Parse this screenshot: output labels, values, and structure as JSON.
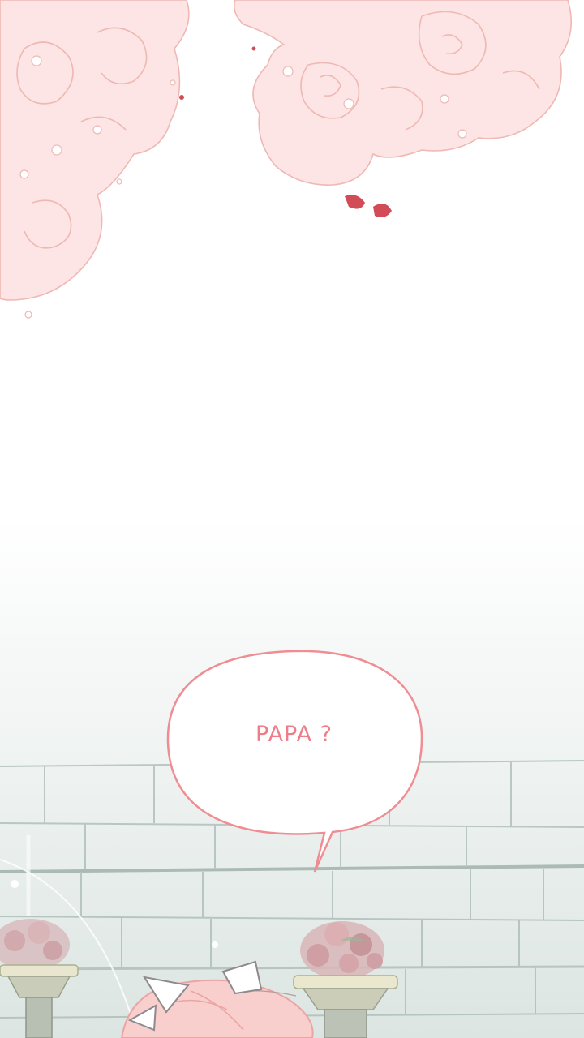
{
  "dialogue": {
    "text": "PAPA ?"
  },
  "colors": {
    "rose_fill": "#fbe3e2",
    "rose_line": "#efb9b5",
    "petal": "#cf4b55",
    "bubble_outline": "#ef8d93",
    "bubble_text": "#ef7c86",
    "mist": "#dfe8e5",
    "stone_line": "#9fb1ab",
    "hair": "#f7c9c6"
  },
  "scene": {
    "elements": [
      "rose-cluster-top",
      "falling-petals",
      "speech-bubble",
      "stone-wall",
      "flower-planters",
      "girl-head-with-bow"
    ]
  }
}
